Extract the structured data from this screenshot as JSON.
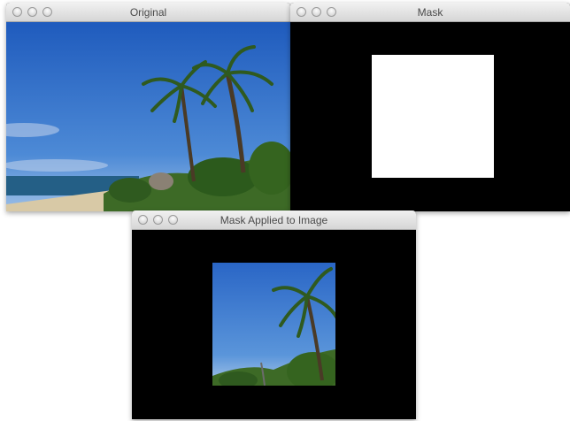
{
  "windows": {
    "original": {
      "title": "Original"
    },
    "mask": {
      "title": "Mask"
    },
    "masked": {
      "title": "Mask Applied to Image"
    }
  },
  "colors": {
    "sky": "#2a68c4",
    "sea": "#245f86",
    "sand": "#d8c9a6",
    "foliage": "#3d6a26",
    "mask_white": "#ffffff",
    "mask_black": "#000000"
  }
}
